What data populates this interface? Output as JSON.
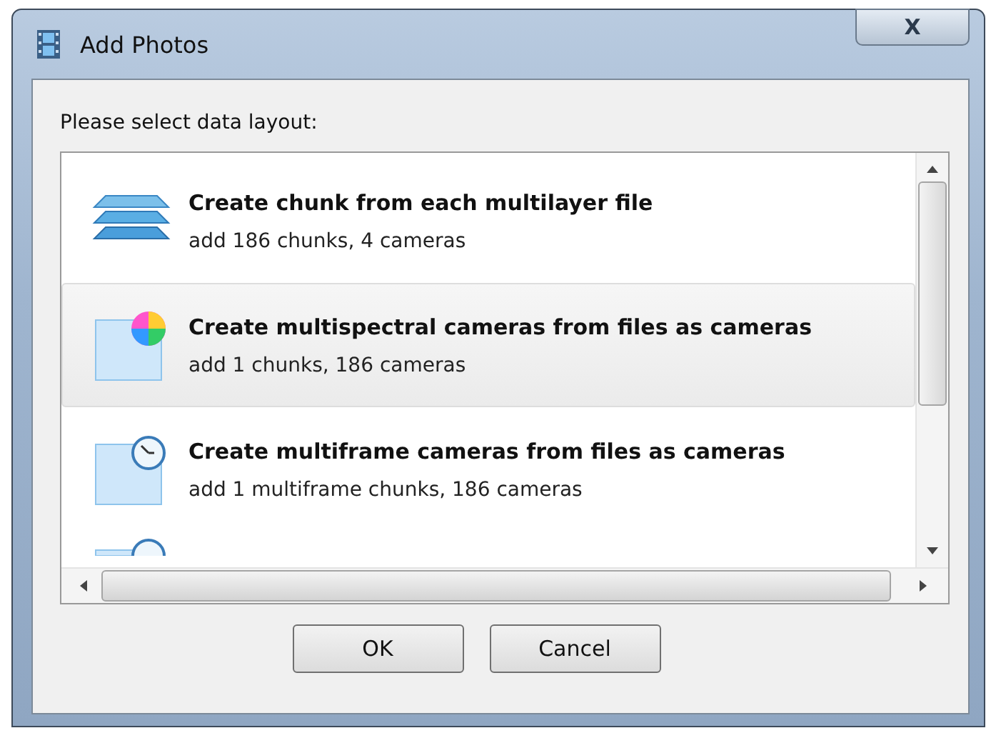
{
  "window": {
    "title": "Add Photos",
    "close": "X"
  },
  "prompt": "Please select data layout:",
  "options": [
    {
      "kind": "layers",
      "title": "Create chunk from each multilayer file",
      "detail": "add 186 chunks, 4 cameras",
      "selected": false
    },
    {
      "kind": "spectrum",
      "title": "Create multispectral cameras from files as cameras",
      "detail": "add 1 chunks, 186 cameras",
      "selected": true
    },
    {
      "kind": "clock",
      "title": "Create multiframe cameras from files as cameras",
      "detail": "add 1 multiframe chunks, 186 cameras",
      "selected": false
    },
    {
      "kind": "clock",
      "selected": false
    }
  ],
  "buttons": [
    "OK",
    "Cancel"
  ]
}
